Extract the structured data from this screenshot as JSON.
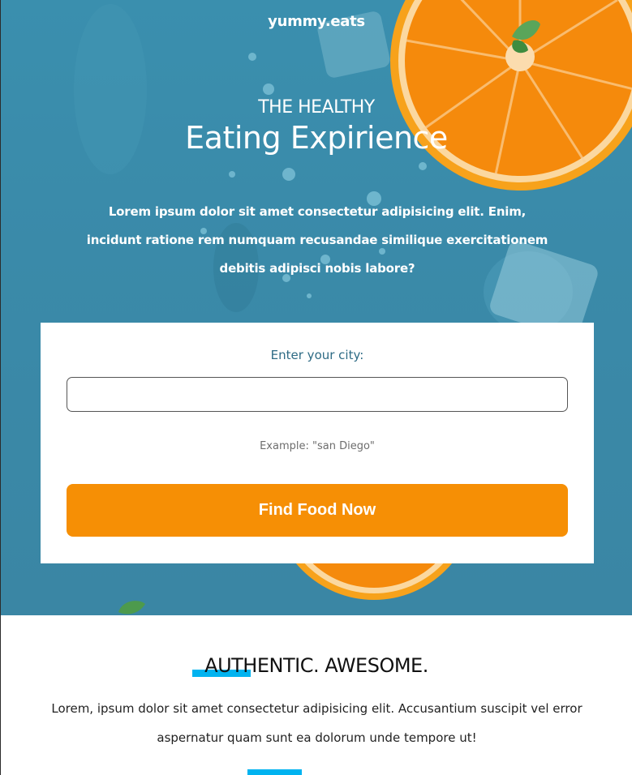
{
  "brand": "yummy.eats",
  "hero": {
    "kicker": "THE HEALTHY",
    "headline": "Eating Expirience",
    "lead": "Lorem ipsum dolor sit amet consectetur adipisicing elit. Enim, incidunt ratione rem numquam recusandae similique exercitationem debitis adipisci nobis labore?"
  },
  "search": {
    "label": "Enter your city:",
    "value": "",
    "placeholder": "",
    "example": "Example: \"san Diego\"",
    "button_label": "Find Food Now"
  },
  "section": {
    "title": "AUTHENTIC. AWESOME.",
    "text": "Lorem, ipsum dolor sit amet consectetur adipisicing elit. Accusantium suscipit vel error aspernatur quam sunt ea dolorum unde tempore ut!"
  },
  "colors": {
    "hero_bg": "#3a8aa9",
    "button": "#f68f05",
    "accent": "#00b3f0",
    "label_text": "#2e6b85"
  },
  "icons": [
    "orange-slice-image",
    "ice-cube-image"
  ]
}
